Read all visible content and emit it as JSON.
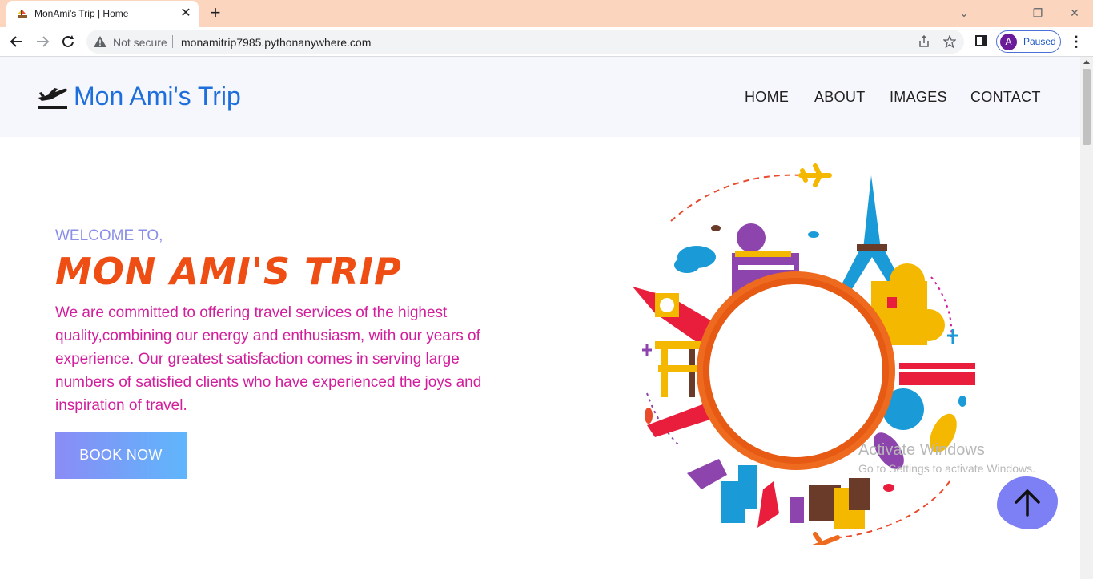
{
  "browser": {
    "tab_title": "MonAmi's Trip | Home",
    "security_label": "Not secure",
    "url": "monamitrip7985.pythonanywhere.com",
    "profile_initial": "A",
    "profile_status": "Paused"
  },
  "site": {
    "logo_text": "Mon Ami's Trip",
    "nav": [
      "HOME",
      "ABOUT",
      "IMAGES",
      "CONTACT"
    ]
  },
  "hero": {
    "welcome": "WELCOME TO,",
    "title": "MON AMI'S TRIP",
    "description": "We are committed to offering travel services of the highest quality,combining our energy and enthusiasm, with our years of experience. Our greatest satisfaction comes in serving large numbers of satisfied clients who have experienced the joys and inspiration of travel.",
    "cta_label": "BOOK NOW"
  },
  "windows_watermark": {
    "title": "Activate Windows",
    "subtitle": "Go to Settings to activate Windows."
  },
  "colors": {
    "tabbar_bg": "#fbd5be",
    "logo_blue": "#1e6fdc",
    "welcome": "#8a8ee6",
    "title_orange": "#ee4d13",
    "description_magenta": "#d21e9c",
    "cta_gradient_start": "#8a8cf6",
    "cta_gradient_end": "#5fb6fb",
    "scroll_top_bg": "#7d7ff5"
  },
  "icons": {
    "tab_favicon": "ship-icon",
    "logo": "airplane-departure-icon",
    "scroll_top": "arrow-up-icon"
  }
}
